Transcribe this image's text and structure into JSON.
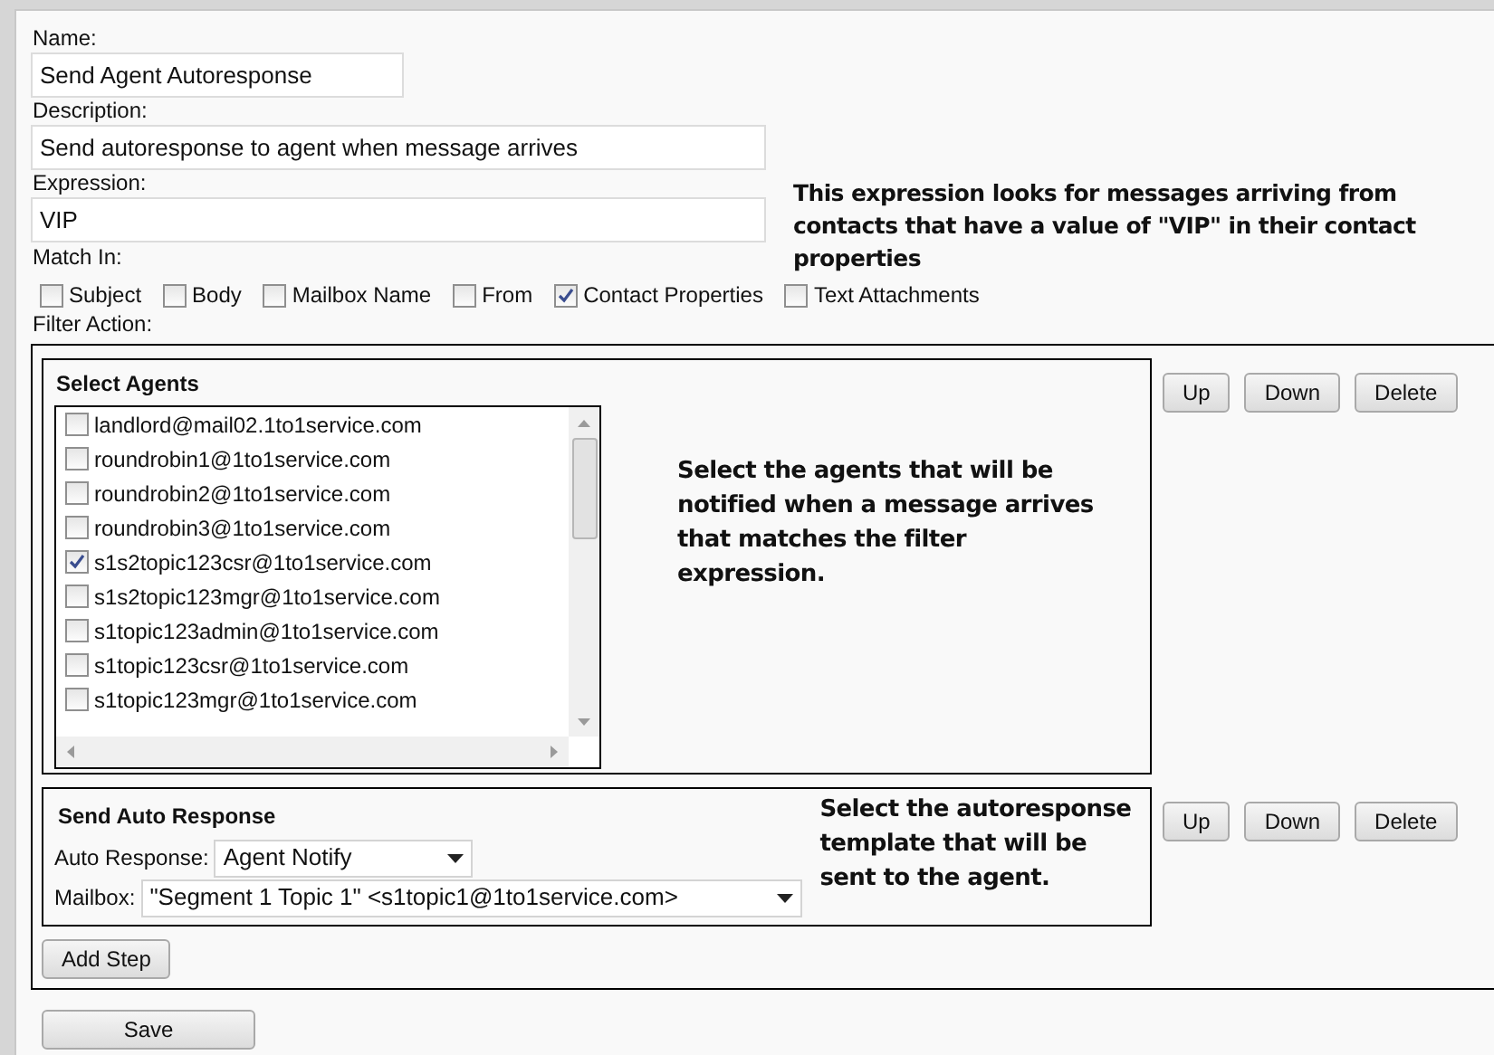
{
  "fields": [
    {
      "label": "Name:",
      "value": "Send Agent Autoresponse"
    },
    {
      "label": "Description:",
      "value": "Send autoresponse to agent when message arrives"
    },
    {
      "label": "Expression:",
      "value": "VIP"
    }
  ],
  "expression_note": "This expression looks for messages arriving from contacts that have a value of \"VIP\" in their contact properties",
  "match_in": {
    "label": "Match In:",
    "options": [
      {
        "label": "Subject",
        "checked": false
      },
      {
        "label": "Body",
        "checked": false
      },
      {
        "label": "Mailbox Name",
        "checked": false
      },
      {
        "label": "From",
        "checked": false
      },
      {
        "label": "Contact Properties",
        "checked": true
      },
      {
        "label": "Text Attachments",
        "checked": false
      }
    ]
  },
  "filter_action": {
    "label": "Filter Action:",
    "steps": [
      {
        "kind": "select_agents",
        "title": "Select Agents",
        "agents": [
          {
            "label": "landlord@mail02.1to1service.com",
            "checked": false
          },
          {
            "label": "roundrobin1@1to1service.com",
            "checked": false
          },
          {
            "label": "roundrobin2@1to1service.com",
            "checked": false
          },
          {
            "label": "roundrobin3@1to1service.com",
            "checked": false
          },
          {
            "label": "s1s2topic123csr@1to1service.com",
            "checked": true
          },
          {
            "label": "s1s2topic123mgr@1to1service.com",
            "checked": false
          },
          {
            "label": "s1topic123admin@1to1service.com",
            "checked": false
          },
          {
            "label": "s1topic123csr@1to1service.com",
            "checked": false
          },
          {
            "label": "s1topic123mgr@1to1service.com",
            "checked": false
          }
        ],
        "note": "Select the agents that will be notified when a message arrives that matches the filter expression.",
        "buttons": [
          "Up",
          "Down",
          "Delete"
        ]
      },
      {
        "kind": "auto_response",
        "title": "Send Auto Response",
        "selects": [
          {
            "label": "Auto Response:",
            "value": "Agent Notify"
          },
          {
            "label": "Mailbox:",
            "value": "\"Segment 1 Topic 1\" <s1topic1@1to1service.com>"
          }
        ],
        "note": "Select the autoresponse template that will be sent to the agent.",
        "buttons": [
          "Up",
          "Down",
          "Delete"
        ]
      }
    ],
    "add_step": "Add Step"
  },
  "save": "Save"
}
